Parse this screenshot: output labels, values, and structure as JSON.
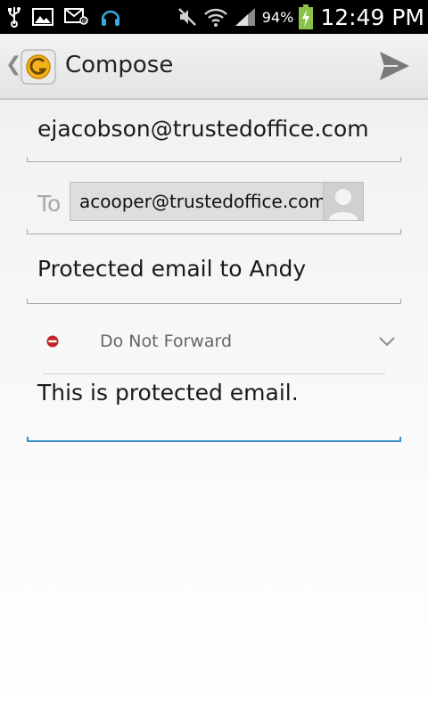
{
  "status_bar": {
    "battery_percent": "94%",
    "time": "12:49 PM",
    "icons": [
      "usb-icon",
      "gallery-icon",
      "email-icon",
      "headset-icon",
      "mute-icon",
      "wifi-icon",
      "signal-icon",
      "battery-charging-icon"
    ]
  },
  "action_bar": {
    "title": "Compose",
    "send_icon": "send-icon",
    "app_icon": "app-logo-icon"
  },
  "compose": {
    "from": "ejacobson@trustedoffice.com",
    "to_label": "To",
    "to_recipient": "acooper@trustedoffice.com",
    "subject": "Protected email to Andy",
    "classification": "Do Not Forward",
    "body": "This is protected email."
  },
  "colors": {
    "accent": "#3a8fc7",
    "no_entry_red": "#c0242b"
  }
}
